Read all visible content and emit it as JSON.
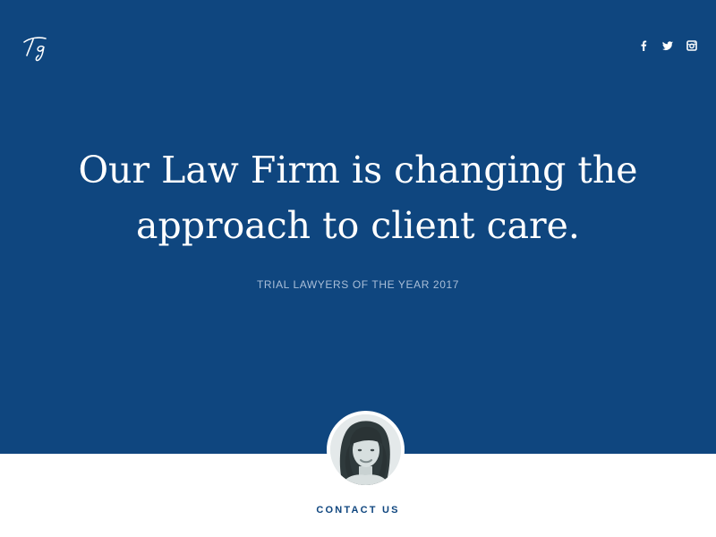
{
  "colors": {
    "hero_background": "#0f467f",
    "accent_text": "#0f467f",
    "subtitle": "#a9bed8",
    "page_background": "#ffffff"
  },
  "logo": {
    "text": "Tg",
    "icon": "signature-logo"
  },
  "social": [
    {
      "name": "facebook",
      "icon": "facebook-icon"
    },
    {
      "name": "twitter",
      "icon": "twitter-icon"
    },
    {
      "name": "instagram",
      "icon": "instagram-icon"
    }
  ],
  "hero": {
    "headline_line1": "Our Law Firm is changing the",
    "headline_line2": "approach to client care.",
    "subtitle": "TRIAL LAWYERS OF THE YEAR 2017"
  },
  "avatar": {
    "icon": "portrait-photo"
  },
  "contact": {
    "label": "CONTACT US"
  }
}
